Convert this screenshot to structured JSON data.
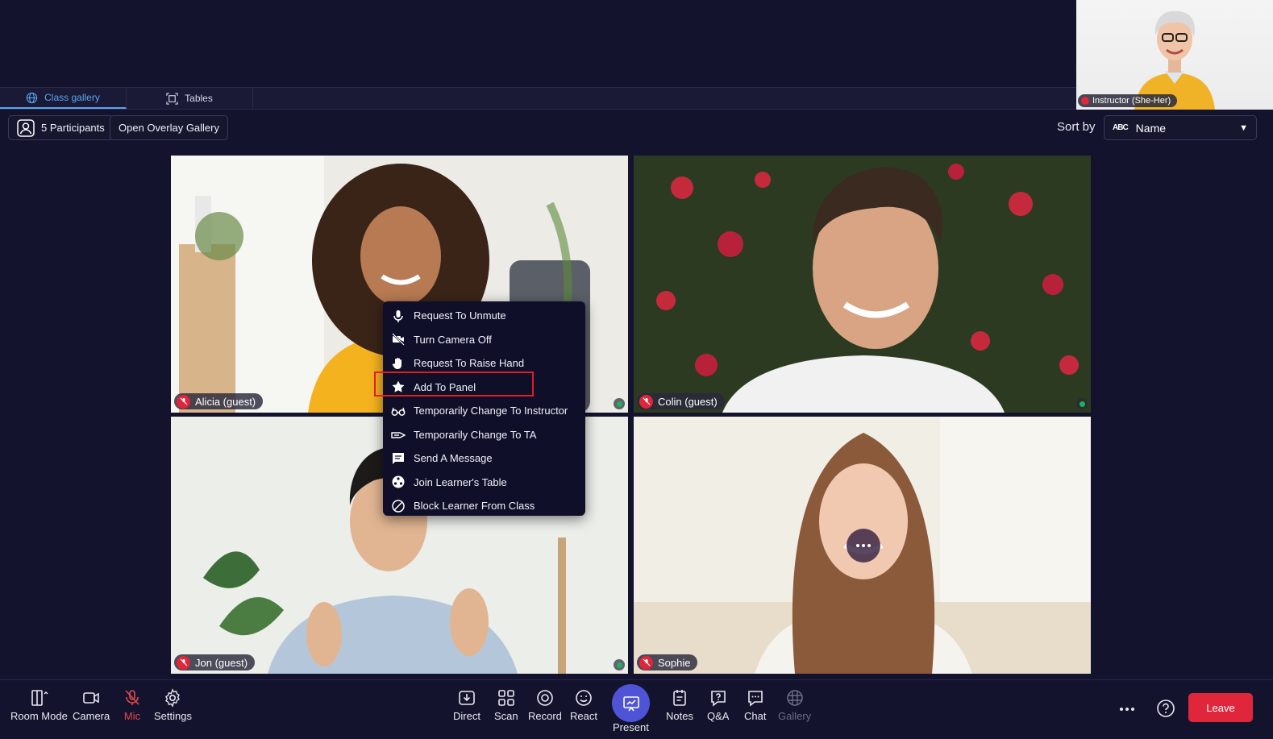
{
  "instructor": {
    "label": "Instructor (She-Her)"
  },
  "tabs": [
    {
      "label": "Class gallery",
      "active": true
    },
    {
      "label": "Tables",
      "active": false
    }
  ],
  "toolbar": {
    "participants_label": "5 Participants",
    "overlay_label": "Open Overlay Gallery",
    "sort_label": "Sort by",
    "sort_value": "Name",
    "sort_icon_text": "ABC"
  },
  "participants": [
    {
      "name": "Alicia (guest)"
    },
    {
      "name": "Colin (guest)"
    },
    {
      "name": "Jon (guest)"
    },
    {
      "name": "Sophie"
    }
  ],
  "context_menu": {
    "items": [
      {
        "label": "Request To Unmute",
        "icon": "mic-icon"
      },
      {
        "label": "Turn Camera Off",
        "icon": "camera-off-icon"
      },
      {
        "label": "Request To Raise Hand",
        "icon": "hand-icon"
      },
      {
        "label": "Add To Panel",
        "icon": "star-icon",
        "highlighted": true
      },
      {
        "label": "Temporarily Change To Instructor",
        "icon": "glasses-icon"
      },
      {
        "label": "Temporarily Change To TA",
        "icon": "ta-icon"
      },
      {
        "label": "Send A Message",
        "icon": "message-icon"
      },
      {
        "label": "Join Learner's Table",
        "icon": "table-icon"
      },
      {
        "label": "Block Learner From Class",
        "icon": "block-icon"
      }
    ]
  },
  "bottom_bar": {
    "room_mode": "Room Mode",
    "camera": "Camera",
    "mic": "Mic",
    "settings": "Settings",
    "direct": "Direct",
    "scan": "Scan",
    "record": "Record",
    "react": "React",
    "present": "Present",
    "notes": "Notes",
    "qa": "Q&A",
    "chat": "Chat",
    "gallery": "Gallery",
    "leave": "Leave"
  },
  "colors": {
    "background": "#13132e",
    "accent": "#5aa3f0",
    "present": "#4f54d6",
    "danger": "#e0263b",
    "highlight_box": "#e01d1d"
  }
}
